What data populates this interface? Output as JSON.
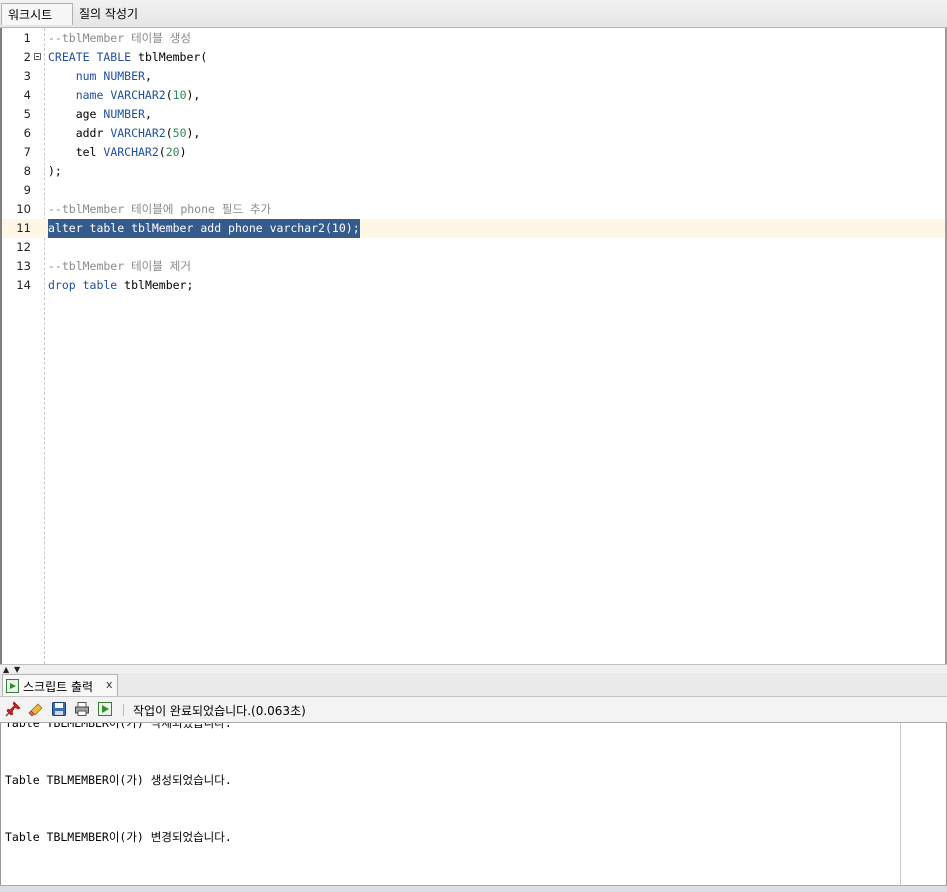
{
  "tabs": {
    "worksheet": "워크시트",
    "query_builder": "질의 작성기"
  },
  "editor": {
    "lines": [
      {
        "num": "1",
        "tokens": [
          {
            "t": "--tblMember 테이블 생성",
            "c": "cm"
          }
        ]
      },
      {
        "num": "2",
        "fold": true,
        "tokens": [
          {
            "t": "CREATE TABLE ",
            "c": "kw"
          },
          {
            "t": "tblMember(",
            "c": "plain"
          }
        ]
      },
      {
        "num": "3",
        "tokens": [
          {
            "t": "    num ",
            "c": "kw"
          },
          {
            "t": "NUMBER",
            "c": "kw"
          },
          {
            "t": ",",
            "c": "plain"
          }
        ]
      },
      {
        "num": "4",
        "tokens": [
          {
            "t": "    name ",
            "c": "kw"
          },
          {
            "t": "VARCHAR2",
            "c": "kw"
          },
          {
            "t": "(",
            "c": "plain"
          },
          {
            "t": "10",
            "c": "num"
          },
          {
            "t": "),",
            "c": "plain"
          }
        ]
      },
      {
        "num": "5",
        "tokens": [
          {
            "t": "    age ",
            "c": "plain"
          },
          {
            "t": "NUMBER",
            "c": "kw"
          },
          {
            "t": ",",
            "c": "plain"
          }
        ]
      },
      {
        "num": "6",
        "tokens": [
          {
            "t": "    addr ",
            "c": "plain"
          },
          {
            "t": "VARCHAR2",
            "c": "kw"
          },
          {
            "t": "(",
            "c": "plain"
          },
          {
            "t": "50",
            "c": "num"
          },
          {
            "t": "),",
            "c": "plain"
          }
        ]
      },
      {
        "num": "7",
        "tokens": [
          {
            "t": "    tel ",
            "c": "plain"
          },
          {
            "t": "VARCHAR2",
            "c": "kw"
          },
          {
            "t": "(",
            "c": "plain"
          },
          {
            "t": "20",
            "c": "num"
          },
          {
            "t": ")",
            "c": "plain"
          }
        ]
      },
      {
        "num": "8",
        "tokens": [
          {
            "t": ");",
            "c": "plain"
          }
        ]
      },
      {
        "num": "9",
        "tokens": []
      },
      {
        "num": "10",
        "tokens": [
          {
            "t": "--tblMember 테이블에 phone 필드 추가",
            "c": "cm"
          }
        ]
      },
      {
        "num": "11",
        "current": true,
        "selected": true,
        "tokens": [
          {
            "t": "alter table ",
            "c": "kw"
          },
          {
            "t": "tblMember ",
            "c": "plain"
          },
          {
            "t": "add ",
            "c": "kw"
          },
          {
            "t": "phone ",
            "c": "plain"
          },
          {
            "t": "varchar2",
            "c": "kw"
          },
          {
            "t": "(",
            "c": "plain"
          },
          {
            "t": "10",
            "c": "num"
          },
          {
            "t": ");",
            "c": "plain"
          }
        ]
      },
      {
        "num": "12",
        "tokens": []
      },
      {
        "num": "13",
        "tokens": [
          {
            "t": "--tblMember 테이블 제거",
            "c": "cm"
          }
        ]
      },
      {
        "num": "14",
        "tokens": [
          {
            "t": "drop table ",
            "c": "kw"
          },
          {
            "t": "tblMember;",
            "c": "plain"
          }
        ]
      }
    ]
  },
  "output_panel": {
    "tab_label": "스크립트 출력",
    "close_glyph": "x",
    "status": "작업이 완료되었습니다.(0.063초)",
    "lines": [
      "Table TBLMEMBER이(가) 삭제되었습니다.",
      "Table TBLMEMBER이(가) 생성되었습니다.",
      "Table TBLMEMBER이(가) 변경되었습니다."
    ]
  },
  "icons": {
    "toolbar": [
      "pin-icon",
      "eraser-icon",
      "save-icon",
      "print-icon",
      "script-output-icon"
    ]
  },
  "colors": {
    "keyword": "#1f4f9f",
    "number": "#2e8b57",
    "comment": "#8a8a8a",
    "selection": "#355b8c",
    "current_line": "#fff7e6"
  }
}
